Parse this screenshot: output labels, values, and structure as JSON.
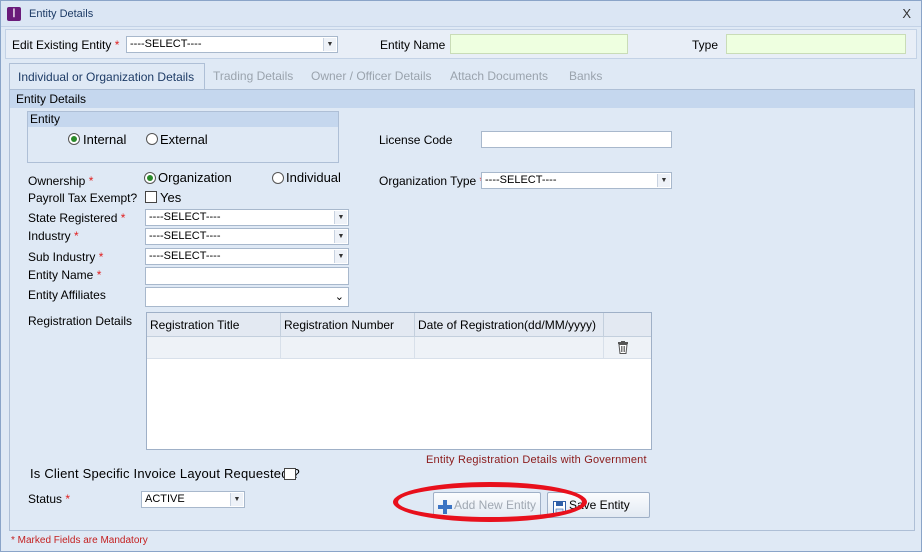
{
  "window": {
    "title": "Entity Details",
    "close": "X"
  },
  "toprow": {
    "edit_label": "Edit Existing Entity",
    "edit_req": "*",
    "edit_value": "----SELECT----",
    "name_label": "Entity Name",
    "type_label": "Type"
  },
  "tabs": [
    "Individual or Organization Details",
    "Trading Details",
    "Owner / Officer Details",
    "Attach Documents",
    "Banks"
  ],
  "section": {
    "title": "Entity Details"
  },
  "entity": {
    "title": "Entity",
    "internal": "Internal",
    "external": "External",
    "selected": "Internal"
  },
  "license": {
    "label": "License Code",
    "value": ""
  },
  "ownership": {
    "label": "Ownership",
    "req": "*",
    "organization": "Organization",
    "individual": "Individual",
    "selected": "Organization"
  },
  "org_type": {
    "label": "Organization Type",
    "req": "*",
    "value": "----SELECT----"
  },
  "payroll": {
    "label": "Payroll Tax Exempt?",
    "option": "Yes",
    "checked": false
  },
  "state": {
    "label": "State Registered",
    "req": "*",
    "value": "----SELECT----"
  },
  "industry": {
    "label": "Industry",
    "req": "*",
    "value": "----SELECT----"
  },
  "sub_industry": {
    "label": "Sub Industry",
    "req": "*",
    "value": "----SELECT----"
  },
  "entity_name": {
    "label": "Entity Name",
    "req": "*",
    "value": ""
  },
  "affiliates": {
    "label": "Entity Affiliates",
    "value": ""
  },
  "registration": {
    "label": "Registration Details",
    "columns": [
      "Registration Title",
      "Registration Number",
      "Date of Registration(dd/MM/yyyy)"
    ],
    "note": "Entity Registration Details with Government"
  },
  "invoice": {
    "label": "Is Client Specific Invoice Layout Requested ?",
    "checked": false
  },
  "status": {
    "label": "Status",
    "req": "*",
    "value": "ACTIVE"
  },
  "buttons": {
    "add": "Add New Entity",
    "save": "Save Entity"
  },
  "footer": {
    "mandatory_note": "* Marked Fields are Mandatory"
  },
  "colors": {
    "highlight_ellipse": "#e8101c",
    "required": "#e02020",
    "note": "#8b1a1a"
  }
}
